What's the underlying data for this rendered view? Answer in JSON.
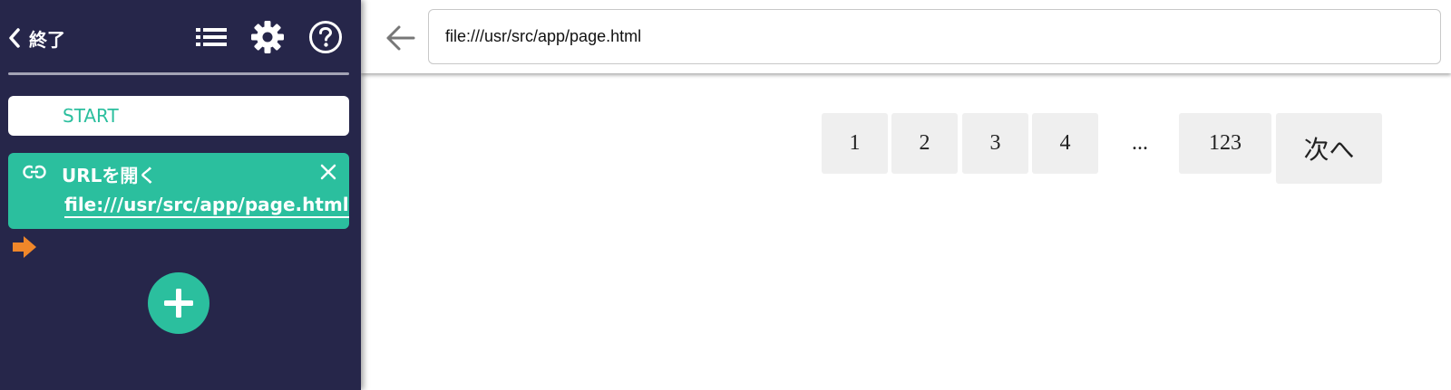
{
  "sidebar": {
    "exit_label": "終了",
    "icons": {
      "back": "chevron-left-icon",
      "list": "list-icon",
      "settings": "gear-icon",
      "help": "help-circle-icon"
    },
    "start_label": "START",
    "step": {
      "title": "URLを開く",
      "url": "file:///usr/src/app/page.html",
      "icon": "link-icon",
      "close_icon": "close-icon"
    },
    "pointer_icon": "arrow-right-icon",
    "add_icon": "plus-icon"
  },
  "browser": {
    "back_icon": "arrow-left-icon",
    "url": "file:///usr/src/app/page.html"
  },
  "pagination": {
    "pages": [
      "1",
      "2",
      "3",
      "4"
    ],
    "ellipsis": "...",
    "last_page": "123",
    "next_label": "次へ"
  },
  "colors": {
    "sidebar_bg": "#26264a",
    "accent": "#2bbf9e",
    "pointer": "#f0872a",
    "page_button_bg": "#efefef"
  }
}
